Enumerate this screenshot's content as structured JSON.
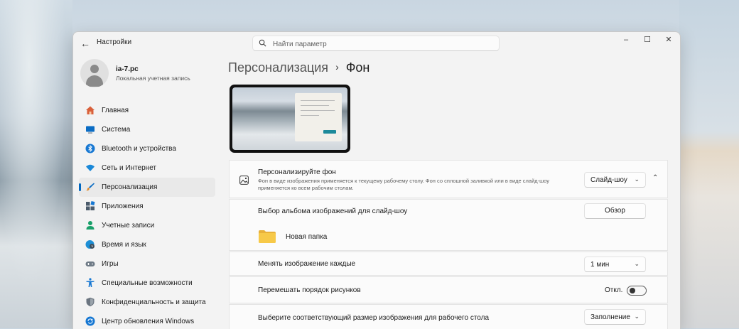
{
  "window": {
    "title": "Настройки"
  },
  "search": {
    "placeholder": "Найти параметр"
  },
  "window_controls": {
    "minimize": "–",
    "maximize": "☐",
    "close": "✕"
  },
  "profile": {
    "name": "ia-7.pc",
    "account_type": "Локальная учетная запись"
  },
  "nav": {
    "items": [
      {
        "label": "Главная",
        "icon": "home-icon",
        "color": "#d9603b"
      },
      {
        "label": "Система",
        "icon": "monitor-icon",
        "color": "#0a6cc4"
      },
      {
        "label": "Bluetooth и устройства",
        "icon": "bluetooth-icon",
        "color": "#1677d2"
      },
      {
        "label": "Сеть и Интернет",
        "icon": "wifi-icon",
        "color": "#1a88d8"
      },
      {
        "label": "Персонализация",
        "icon": "brush-icon",
        "color": "#e08a2a",
        "active": true
      },
      {
        "label": "Приложения",
        "icon": "apps-icon",
        "color": "#4b5b6b"
      },
      {
        "label": "Учетные записи",
        "icon": "person-icon",
        "color": "#1aa06a"
      },
      {
        "label": "Время и язык",
        "icon": "globe-clock-icon",
        "color": "#1d8fd6"
      },
      {
        "label": "Игры",
        "icon": "gamepad-icon",
        "color": "#6e7a86"
      },
      {
        "label": "Специальные возможности",
        "icon": "accessibility-icon",
        "color": "#1677d2"
      },
      {
        "label": "Конфиденциальность и защита",
        "icon": "shield-icon",
        "color": "#6b7580"
      },
      {
        "label": "Центр обновления Windows",
        "icon": "update-icon",
        "color": "#1677d2"
      }
    ]
  },
  "breadcrumb": {
    "parent": "Персонализация",
    "separator": "›",
    "current": "Фон"
  },
  "background": {
    "title": "Персонализируйте фон",
    "description": "Фон в виде изображения применяется к текущему рабочему столу. Фон со сплошной заливкой или в виде слайд-шоу применяется ко всем рабочим столам.",
    "type_value": "Слайд-шоу"
  },
  "album": {
    "label": "Выбор альбома изображений для слайд-шоу",
    "browse_label": "Обзор",
    "folder_name": "Новая папка"
  },
  "interval": {
    "label": "Менять изображение каждые",
    "value": "1 мин"
  },
  "shuffle": {
    "label": "Перемешать порядок рисунков",
    "state_label": "Откл.",
    "on": false
  },
  "fit": {
    "label": "Выберите соответствующий размер изображения для рабочего стола",
    "value": "Заполнение"
  },
  "colors": {
    "accent": "#0067c0"
  }
}
